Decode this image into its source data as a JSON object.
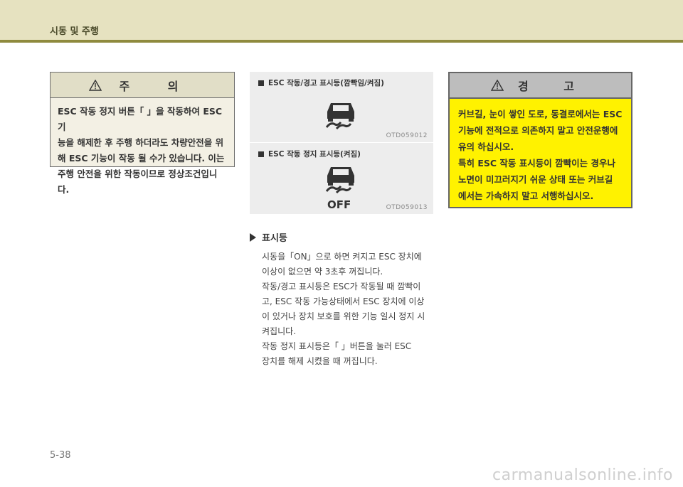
{
  "header": {
    "section_title": "시동 및 주행"
  },
  "caution": {
    "title": "주 의",
    "lines": [
      "ESC 작동 정지 버튼「 」을 작동하여 ESC 기",
      "능을 해제한 후 주행 하더라도 차량안전을 위",
      "해 ESC 기능이 작동 될 수가 있습니다. 이는",
      "주행 안전을 위한 작동이므로 정상조건입니다."
    ]
  },
  "panels": [
    {
      "caption": "ESC 작동/경고 표시등(깜빡임/켜짐)",
      "code": "OTD059012"
    },
    {
      "caption": "ESC 작동 정지 표시등(켜짐)",
      "code": "OTD059013",
      "off_label": "OFF"
    }
  ],
  "indicator": {
    "heading": "표시등",
    "lines": [
      "시동을「ON」으로 하면 켜지고 ESC 장치에",
      "이상이 없으면 약 3초후 꺼집니다.",
      "작동/경고 표시등은 ESC가 작동될 때 깜빡이",
      "고, ESC 작동 가능상태에서 ESC 장치에 이상",
      "이 있거나 장치 보호를 위한 기능 일시 정지 시",
      "켜집니다.",
      "작동 정지 표시등은「 」버튼을 눌러 ESC",
      "장치를 해제 시켰을 때 꺼집니다."
    ]
  },
  "warning": {
    "title": "경 고",
    "lines": [
      "커브길, 눈이 쌓인 도로, 동결로에서는 ESC",
      "기능에 전적으로 의존하지 말고 안전운행에",
      "유의 하십시오.",
      "특히 ESC 작동 표시등이 깜빡이는 경우나",
      "노면이 미끄러지기 쉬운 상태 또는 커브길",
      "에서는 가속하지 말고 서행하십시오."
    ]
  },
  "footer": {
    "page_number": "5-38",
    "watermark": "carmanualsonline.info"
  },
  "colors": {
    "header_band": "#e6e2c0",
    "header_line": "#8f8a3e",
    "warning_fill": "#fff200",
    "caution_fill": "#f3f0e4"
  },
  "icons": [
    "warning-triangle-icon",
    "esc-skid-car-icon",
    "esc-off-button-icon"
  ]
}
